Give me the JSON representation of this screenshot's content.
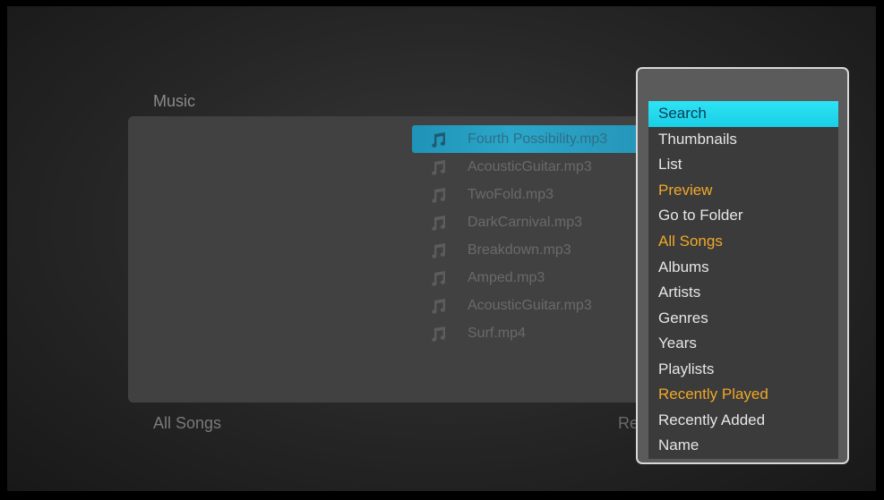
{
  "browser": {
    "title": "Music",
    "footer_left": "All Songs",
    "footer_right": "Re",
    "files": [
      {
        "name": "Fourth Possibility.mp3",
        "selected": true
      },
      {
        "name": "AcousticGuitar.mp3",
        "selected": false
      },
      {
        "name": "TwoFold.mp3",
        "selected": false
      },
      {
        "name": "DarkCarnival.mp3",
        "selected": false
      },
      {
        "name": "Breakdown.mp3",
        "selected": false
      },
      {
        "name": "Amped.mp3",
        "selected": false
      },
      {
        "name": "AcousticGuitar.mp3",
        "selected": false
      },
      {
        "name": "Surf.mp4",
        "selected": false
      }
    ]
  },
  "menu": {
    "groups": [
      {
        "items": [
          {
            "label": "Search",
            "state": "highlight"
          },
          {
            "label": "Thumbnails",
            "state": "normal"
          },
          {
            "label": "List",
            "state": "normal"
          },
          {
            "label": "Preview",
            "state": "accent"
          }
        ]
      },
      {
        "items": [
          {
            "label": "Go to Folder",
            "state": "normal"
          }
        ]
      },
      {
        "items": [
          {
            "label": "All Songs",
            "state": "accent"
          },
          {
            "label": "Albums",
            "state": "normal"
          },
          {
            "label": "Artists",
            "state": "normal"
          },
          {
            "label": "Genres",
            "state": "normal"
          },
          {
            "label": "Years",
            "state": "normal"
          },
          {
            "label": "Playlists",
            "state": "normal"
          }
        ]
      },
      {
        "items": [
          {
            "label": "Recently Played",
            "state": "accent"
          },
          {
            "label": "Recently Added",
            "state": "normal"
          },
          {
            "label": "Name",
            "state": "normal"
          }
        ]
      }
    ]
  },
  "icons": {
    "file": "music-note-icon"
  },
  "colors": {
    "accent": "#f0a828",
    "highlight": "#22d9ee",
    "selection": "#2496ba"
  }
}
